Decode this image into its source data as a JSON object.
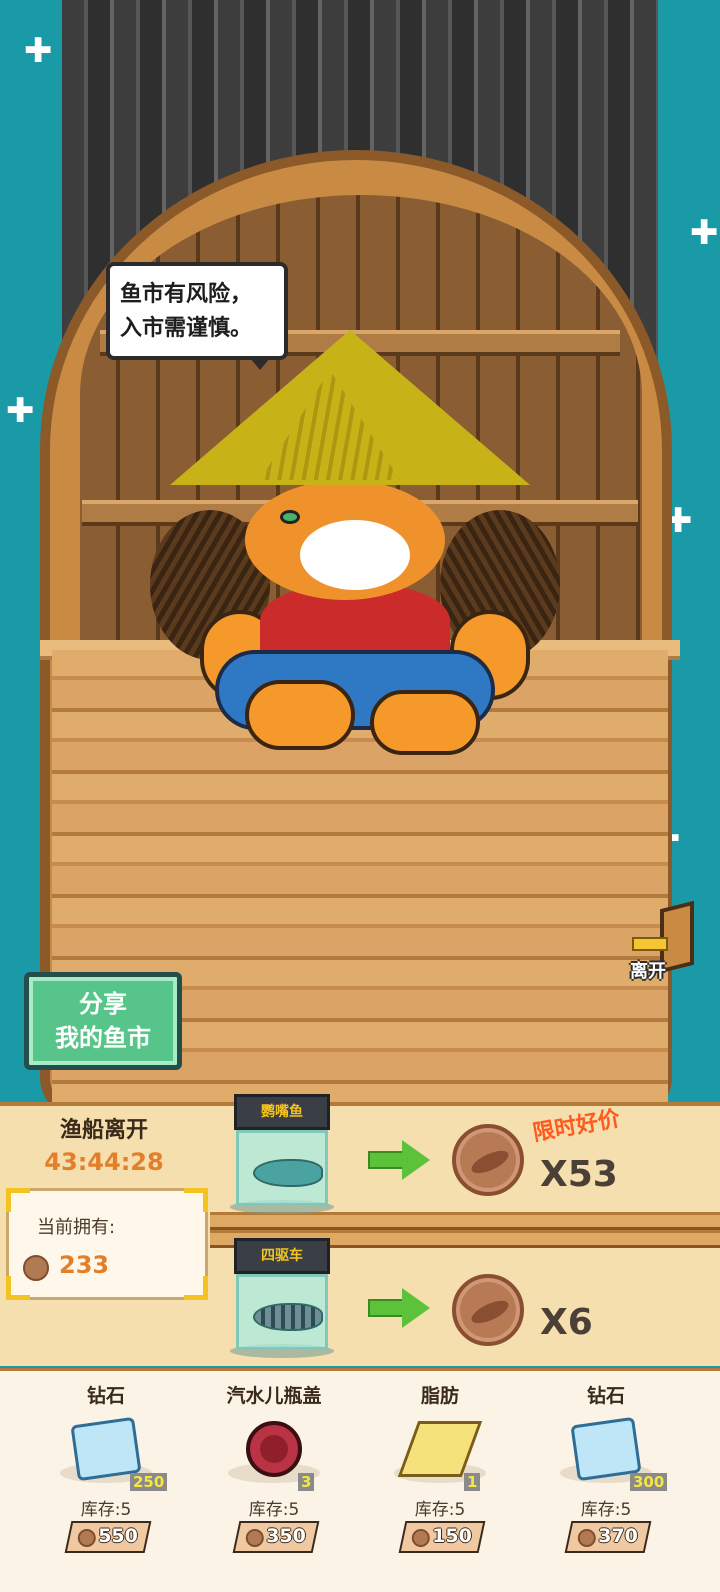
{
  "speech": {
    "line1": "鱼市有风险，",
    "line2": "入市需谨慎。"
  },
  "share_button": {
    "line1": "分享",
    "line2": "我的鱼市"
  },
  "leave_label": "离开",
  "boat_status": {
    "title": "渔船离开",
    "countdown": "43:44:28"
  },
  "wallet": {
    "label": "当前拥有:",
    "amount": "233"
  },
  "trades": [
    {
      "item": "鹦嘴鱼",
      "icon": "parrotfish-icon",
      "reward": "X53",
      "promo": "限时好价"
    },
    {
      "item": "四驱车",
      "icon": "four-wheel-car-icon",
      "reward": "X6"
    }
  ],
  "shop": [
    {
      "name": "钻石",
      "icon": "diamond-icon",
      "count": "250",
      "stock": "库存:5",
      "price": "550"
    },
    {
      "name": "汽水儿瓶盖",
      "icon": "bottle-cap-icon",
      "count": "3",
      "stock": "库存:5",
      "price": "350"
    },
    {
      "name": "脂肪",
      "icon": "fat-block-icon",
      "count": "1",
      "stock": "库存:5",
      "price": "150"
    },
    {
      "name": "钻石",
      "icon": "diamond-icon",
      "count": "300",
      "stock": "库存:5",
      "price": "370"
    }
  ],
  "colors": {
    "sea": "#1a9aa6",
    "accent_orange": "#e27f2a",
    "promo_red": "#ff5a1f",
    "share_green": "#57c489"
  }
}
